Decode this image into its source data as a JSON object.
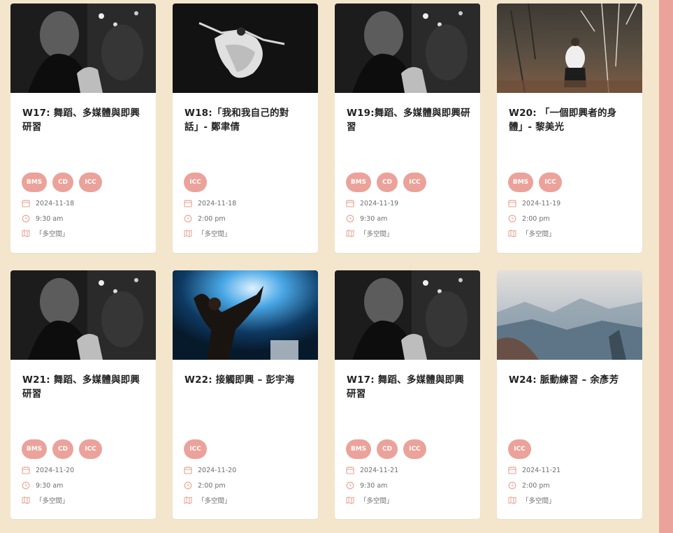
{
  "colors": {
    "background": "#f4e6cc",
    "card": "#ffffff",
    "tag": "#eba29a",
    "icon": "#e8a08f",
    "accent_strip": "#eba29a"
  },
  "icons": {
    "date": "calendar-icon",
    "time": "clock-icon",
    "location": "map-icon"
  },
  "events": [
    {
      "title": "W17: 舞蹈、多媒體與即興研習",
      "tags": [
        "BMS",
        "CD",
        "ICC"
      ],
      "date": "2024-11-18",
      "time": "9:30 am",
      "location": "「多空間」",
      "image": "rehearsal-bw"
    },
    {
      "title": "W18:「我和我自己的對話」- 鄭聿倩",
      "tags": [
        "ICC"
      ],
      "date": "2024-11-18",
      "time": "2:00 pm",
      "location": "「多空間」",
      "image": "dancer-leap"
    },
    {
      "title": "W19:舞蹈、多媒體與即興研習",
      "tags": [
        "BMS",
        "CD",
        "ICC"
      ],
      "date": "2024-11-19",
      "time": "9:30 am",
      "location": "「多空間」",
      "image": "rehearsal-bw"
    },
    {
      "title": "W20: 「一個即興者的身體」- 黎美光",
      "tags": [
        "BMS",
        "ICC"
      ],
      "date": "2024-11-19",
      "time": "2:00 pm",
      "location": "「多空間」",
      "image": "forest-dancer"
    },
    {
      "title": "W21: 舞蹈、多媒體與即興研習",
      "tags": [
        "BMS",
        "CD",
        "ICC"
      ],
      "date": "2024-11-20",
      "time": "9:30 am",
      "location": "「多空間」",
      "image": "rehearsal-bw"
    },
    {
      "title": "W22: 接觸即興 – 彭宇海",
      "tags": [
        "ICC"
      ],
      "date": "2024-11-20",
      "time": "2:00 pm",
      "location": "「多空間」",
      "image": "stage-blue"
    },
    {
      "title": "W17: 舞蹈、多媒體與即興研習",
      "tags": [
        "BMS",
        "CD",
        "ICC"
      ],
      "date": "2024-11-21",
      "time": "9:30 am",
      "location": "「多空間」",
      "image": "rehearsal-bw"
    },
    {
      "title": "W24: 脈動練習 – 余彥芳",
      "tags": [
        "ICC"
      ],
      "date": "2024-11-21",
      "time": "2:00 pm",
      "location": "「多空間」",
      "image": "mountain-mist"
    }
  ]
}
